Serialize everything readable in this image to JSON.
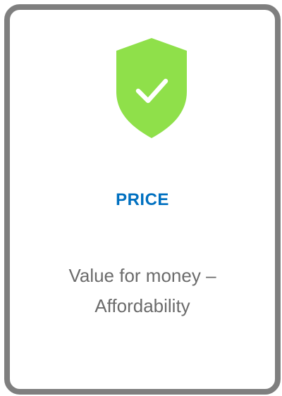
{
  "card": {
    "icon": "shield-check-icon",
    "title": "PRICE",
    "description_line1": "Value for money –",
    "description_line2": "Affordability"
  },
  "colors": {
    "border": "#7f7f7f",
    "shield": "#8fe04a",
    "title": "#0070c0",
    "description": "#6b6b6b"
  }
}
